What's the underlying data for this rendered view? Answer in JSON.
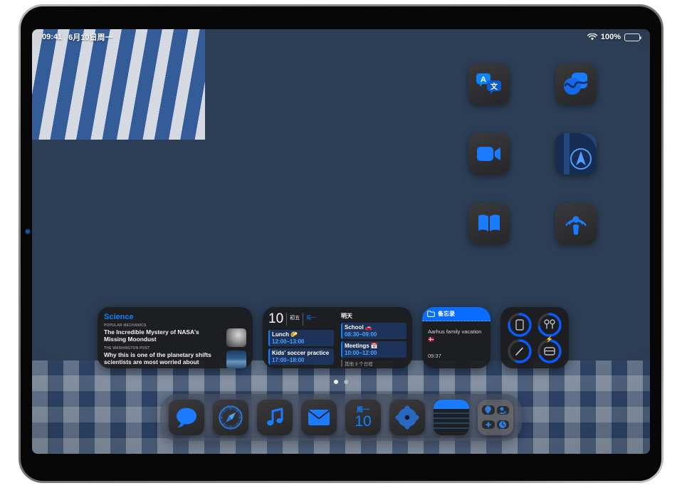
{
  "status_bar": {
    "time": "09:41",
    "date": "6月10日周一",
    "wifi_icon": "wifi-icon",
    "battery_percent": "100%",
    "battery_icon": "battery-icon"
  },
  "home_screen": {
    "apps": [
      {
        "name": "translate",
        "label": "Translate",
        "icon": "translate-icon"
      },
      {
        "name": "freeform",
        "label": "Freeform",
        "icon": "freeform-icon"
      },
      {
        "name": "facetime",
        "label": "FaceTime",
        "icon": "facetime-icon"
      },
      {
        "name": "maps",
        "label": "Maps",
        "icon": "maps-icon"
      },
      {
        "name": "books",
        "label": "Books",
        "icon": "books-icon"
      },
      {
        "name": "podcasts",
        "label": "Podcasts",
        "icon": "podcasts-icon"
      }
    ],
    "page_dots": {
      "count": 2,
      "active_index": 0
    }
  },
  "widgets": {
    "news": {
      "title": "Science",
      "items": [
        {
          "source": "POPULAR MECHANICS",
          "headline": "The Incredible Mystery of NASA's Missing Moondust",
          "thumbnail": "moon-dust-thumbnail"
        },
        {
          "source": "The Washington Post",
          "headline": "Why this is one of the planetary shifts scientists are most worried about",
          "thumbnail": "water-landscape-thumbnail"
        }
      ]
    },
    "calendar": {
      "day_number": "10",
      "lunar_date": "初五",
      "weekday": "周一",
      "today_events": [
        {
          "title": "Lunch 🌮",
          "time": "12:00–13:00"
        },
        {
          "title": "Kids' soccer practice",
          "time": "17:00–18:00"
        }
      ],
      "tomorrow_label": "明天",
      "tomorrow_events": [
        {
          "title": "School 🚗",
          "time": "08:30–09:00"
        },
        {
          "title": "Meetings 📅",
          "time": "10:00–12:00"
        }
      ],
      "more_label": "其他 3 个日程"
    },
    "notes": {
      "header_label": "备忘录",
      "folder_icon": "folder-icon",
      "note_text": "Aarhus family vacation 🇩🇰",
      "timestamp": "09:37"
    },
    "battery": {
      "devices": [
        {
          "name": "ipad",
          "icon": "ipad-icon",
          "level": 78,
          "charging": false
        },
        {
          "name": "airpods",
          "icon": "airpods-icon",
          "level": 72,
          "charging": false
        },
        {
          "name": "apple-pencil",
          "icon": "apple-pencil-icon",
          "level": 55,
          "charging": false
        },
        {
          "name": "airpods-case",
          "icon": "airpods-case-icon",
          "level": 68,
          "charging": true
        }
      ],
      "accent_color": "#0a5bff"
    }
  },
  "dock": {
    "items": [
      {
        "name": "messages",
        "label": "Messages",
        "icon": "messages-icon"
      },
      {
        "name": "safari",
        "label": "Safari",
        "icon": "safari-icon"
      },
      {
        "name": "music",
        "label": "Music",
        "icon": "music-icon"
      },
      {
        "name": "mail",
        "label": "Mail",
        "icon": "mail-icon"
      },
      {
        "name": "calendar",
        "label": "Calendar",
        "icon": "calendar-icon",
        "weekday": "周一",
        "day": "10"
      },
      {
        "name": "photos",
        "label": "Photos",
        "icon": "photos-icon"
      },
      {
        "name": "notes",
        "label": "Notes",
        "icon": "notes-icon"
      },
      {
        "name": "folder",
        "label": "App Folder",
        "icon": "folder-icon"
      }
    ]
  },
  "colors": {
    "accent_blue": "#0a84ff",
    "widget_background": "#1c1c1e",
    "icon_background": "#2f2f31"
  }
}
